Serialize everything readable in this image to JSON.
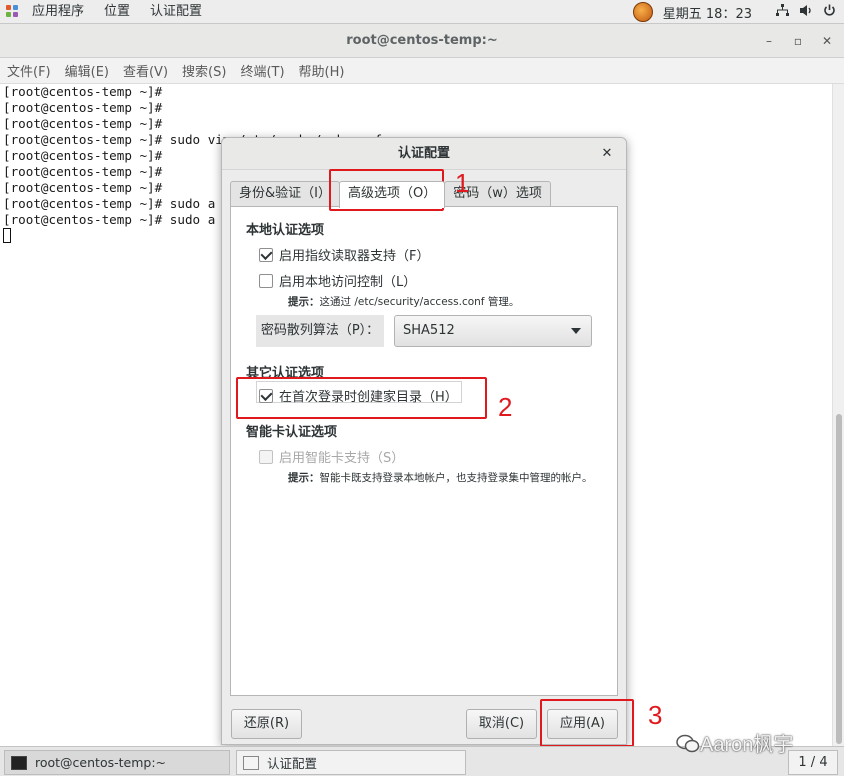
{
  "top_panel": {
    "menu": [
      "应用程序",
      "位置",
      "认证配置"
    ],
    "clock": "星期五 18：23",
    "icons": [
      "network-icon",
      "volume-icon",
      "power-icon"
    ]
  },
  "terminal": {
    "title": "root@centos-temp:~",
    "menu": [
      "文件(F)",
      "编辑(E)",
      "查看(V)",
      "搜索(S)",
      "终端(T)",
      "帮助(H)"
    ],
    "lines": [
      "[root@centos-temp ~]#",
      "[root@centos-temp ~]#",
      "[root@centos-temp ~]#",
      "[root@centos-temp ~]# sudo vim /etc/samba/smb.conf",
      "[root@centos-temp ~]#",
      "[root@centos-temp ~]#",
      "[root@centos-temp ~]#",
      "[root@centos-temp ~]# sudo a",
      "[root@centos-temp ~]# sudo a"
    ]
  },
  "dialog": {
    "title": "认证配置",
    "tabs": [
      "身份&验证（I）",
      "高级选项（O）",
      "密码（w）选项"
    ],
    "local_section": "本地认证选项",
    "fingerprint": "启用指纹读取器支持（F）",
    "local_access": "启用本地访问控制（L）",
    "hint_label": "提示：",
    "hint_local": "这通过 /etc/security/access.conf 管理。",
    "hash_label": "密码散列算法（P）：",
    "hash_value": "SHA512",
    "other_section": "其它认证选项",
    "homedir": "在首次登录时创建家目录（H）",
    "smartcard_section": "智能卡认证选项",
    "smartcard": "启用智能卡支持（S）",
    "hint_smartcard": "智能卡既支持登录本地帐户，也支持登录集中管理的帐户。",
    "revert": "还原(R)",
    "cancel": "取消(C)",
    "apply": "应用(A)"
  },
  "annotations": [
    "1",
    "2",
    "3"
  ],
  "taskbar": {
    "items": [
      "root@centos-temp:~",
      "认证配置"
    ],
    "pager": "1 / 4"
  },
  "watermark": "Aaron枫宇",
  "colors": {
    "annotation": "#e0191f"
  }
}
